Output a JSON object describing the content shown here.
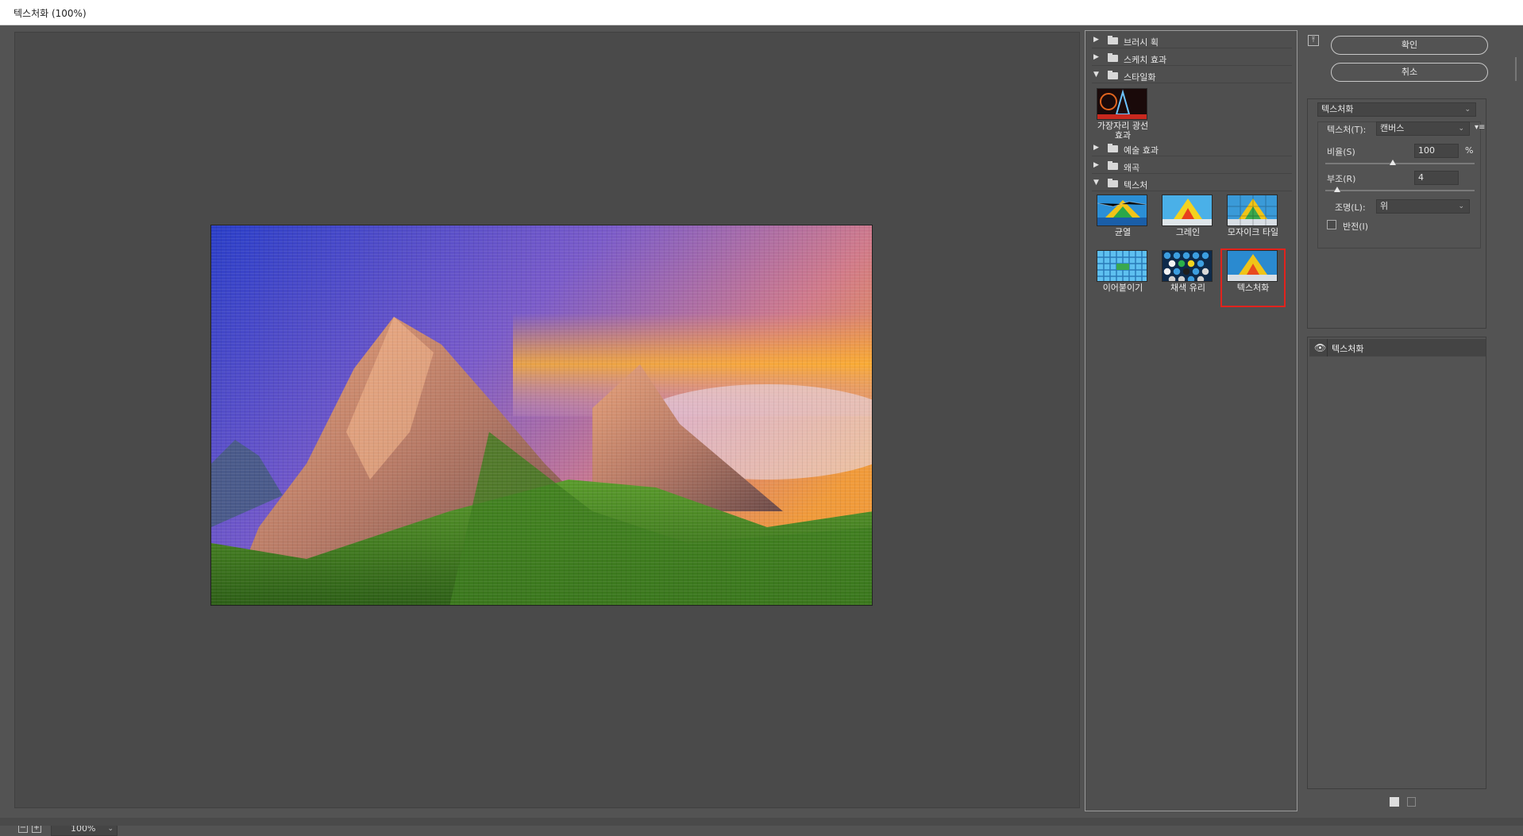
{
  "window": {
    "title": "텍스처화 (100%)"
  },
  "zoom": {
    "value": "100%",
    "minus": "−",
    "plus": "+"
  },
  "categories": [
    {
      "label": "브러시 획",
      "expanded": false
    },
    {
      "label": "스케치 효과",
      "expanded": false
    },
    {
      "label": "스타일화",
      "expanded": true
    },
    {
      "label": "예술 효과",
      "expanded": false
    },
    {
      "label": "왜곡",
      "expanded": false
    },
    {
      "label": "텍스처",
      "expanded": true
    }
  ],
  "stylize_thumbs": [
    {
      "label": "가장자리 광선\n효과"
    }
  ],
  "texture_thumbs": [
    {
      "label": "균열"
    },
    {
      "label": "그레인"
    },
    {
      "label": "모자이크 타일"
    },
    {
      "label": "이어붙이기"
    },
    {
      "label": "채색 유리"
    },
    {
      "label": "텍스처화",
      "selected": true
    }
  ],
  "buttons": {
    "ok": "확인",
    "cancel": "취소"
  },
  "settings": {
    "filter_select": "텍스처화",
    "texture_label": "텍스처(T):",
    "texture_value": "캔버스",
    "scale_label": "비율(S)",
    "scale_value": "100",
    "scale_unit": "%",
    "scale_level": 0.45,
    "relief_label": "부조(R)",
    "relief_value": "4",
    "relief_level": 0.08,
    "light_label": "조명(L):",
    "light_value": "위",
    "invert_label": "반전(I)",
    "invert_checked": false
  },
  "layers": [
    {
      "label": "텍스처화",
      "visible": true
    }
  ],
  "icons": {
    "arrow_collapsed": "▶",
    "arrow_expanded": "▼",
    "chevron": "⌄",
    "eye": "👁",
    "menu": "▾≡",
    "collapse": "⤒"
  }
}
